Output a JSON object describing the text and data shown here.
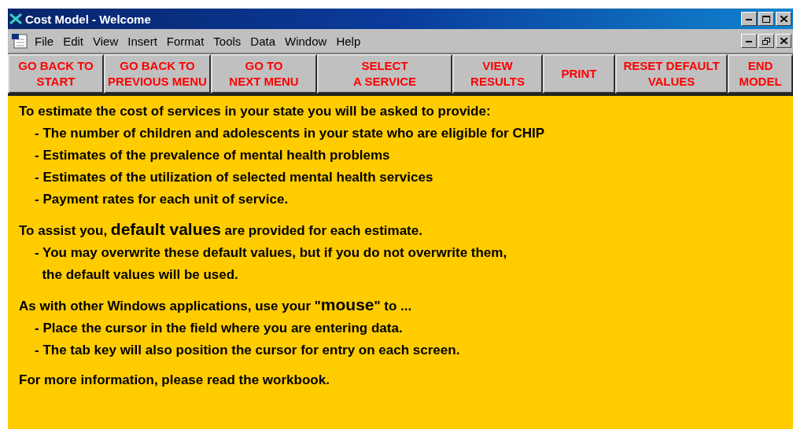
{
  "window": {
    "title": "Cost Model - Welcome"
  },
  "menu": [
    "File",
    "Edit",
    "View",
    "Insert",
    "Format",
    "Tools",
    "Data",
    "Window",
    "Help"
  ],
  "nav_buttons": [
    {
      "lines": [
        "GO BACK TO",
        "START"
      ]
    },
    {
      "lines": [
        "GO BACK TO",
        "PREVIOUS MENU"
      ]
    },
    {
      "lines": [
        "GO TO",
        "NEXT MENU"
      ]
    },
    {
      "lines": [
        "SELECT",
        "A SERVICE"
      ]
    },
    {
      "lines": [
        "VIEW",
        "RESULTS"
      ]
    },
    {
      "lines": [
        "PRINT"
      ]
    },
    {
      "lines": [
        "RESET DEFAULT",
        "VALUES"
      ]
    },
    {
      "lines": [
        "END",
        "MODEL"
      ]
    }
  ],
  "sections": [
    {
      "heading": "To estimate the cost of services in your state you will be asked to provide:",
      "items": [
        "- The number of children and adolescents in your state who are eligible for CHIP",
        "- Estimates of the prevalence of mental health problems",
        "- Estimates of the utilization of selected mental health services",
        "- Payment rates for each unit of service."
      ]
    },
    {
      "heading": "To assist you, **default values** are provided for each estimate.",
      "items": [
        "- You may overwrite these default values, but if you do not overwrite them,",
        "  the default values will be used."
      ]
    },
    {
      "heading": "As with other Windows applications, use your \"**mouse**\" to ...",
      "items": [
        "- Place the cursor in the field where you are entering data.",
        "- The tab key will also position the cursor for entry on each screen."
      ]
    },
    {
      "heading": "For more information, please read the workbook."
    }
  ]
}
